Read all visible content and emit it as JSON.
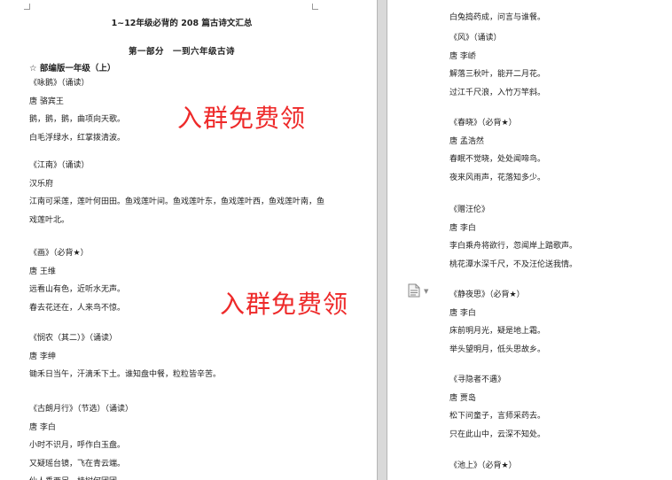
{
  "left_page": {
    "title": "1~12年级必背的 208 篇古诗文汇总",
    "part": "第一部分　一到六年级古诗",
    "grade": "☆ 部编版一年级（上）",
    "poems": [
      {
        "title": "《咏鹅》（诵读）",
        "author": "唐 骆宾王",
        "lines": [
          "鹅，鹅，鹅，曲项向天歌。",
          "白毛浮绿水，红掌拨清波。"
        ]
      },
      {
        "title": "《江南》（诵读）",
        "author": "汉乐府",
        "lines": [
          "江南可采莲，莲叶何田田。鱼戏莲叶间。鱼戏莲叶东，鱼戏莲叶西，鱼戏莲叶南，鱼戏莲叶北。"
        ]
      },
      {
        "title": "《画》（必背★）",
        "author": "唐 王维",
        "lines": [
          "远看山有色，近听水无声。",
          "春去花还在，人来鸟不惊。"
        ]
      },
      {
        "title": "《悯农（其二）》（诵读）",
        "author": "唐 李绅",
        "lines": [
          "锄禾日当午，汗滴禾下土。谁知盘中餐，粒粒皆辛苦。"
        ]
      },
      {
        "title": "《古朗月行》（节选）（诵读）",
        "author": "唐 李白",
        "lines": [
          "小时不识月，呼作白玉盘。",
          "又疑瑶台镜，飞在青云端。",
          "仙人垂两足，桂树何团团。"
        ]
      }
    ]
  },
  "right_page": {
    "poems": [
      {
        "title": "",
        "author": "",
        "lines": [
          "白兔捣药成，问言与谁餐。"
        ]
      },
      {
        "title": "《风》（诵读）",
        "author": "唐 李峤",
        "lines": [
          "解落三秋叶，能开二月花。",
          "过江千尺浪，入竹万竿斜。"
        ]
      },
      {
        "title": "《春晓》（必背★）",
        "author": "唐 孟浩然",
        "lines": [
          "春眠不觉晓，处处闻啼鸟。",
          "夜来风雨声，花落知多少。"
        ]
      },
      {
        "title": "《赠汪伦》",
        "author": "唐 李白",
        "lines": [
          "李白乘舟将欲行，忽闻岸上踏歌声。",
          "桃花潭水深千尺，不及汪伦送我情。"
        ]
      },
      {
        "title": "《静夜思》（必背★）",
        "author": "唐 李白",
        "lines": [
          "床前明月光，疑是地上霜。",
          "举头望明月，低头思故乡。"
        ]
      },
      {
        "title": "《寻隐者不遇》",
        "author": "唐 贾岛",
        "lines": [
          "松下问童子，言师采药去。",
          "只在此山中，云深不知处。"
        ]
      },
      {
        "title": "《池上》（必背★）",
        "author": "",
        "lines": []
      }
    ]
  },
  "watermarks": [
    "入群免费领",
    "入群免费领"
  ],
  "colors": {
    "watermark": "#ee2a2a",
    "gutter": "#d9d9d9",
    "text": "#222222"
  },
  "icons": {
    "margin_icon": "document-icon",
    "margin_caret": "caret-down-icon"
  }
}
